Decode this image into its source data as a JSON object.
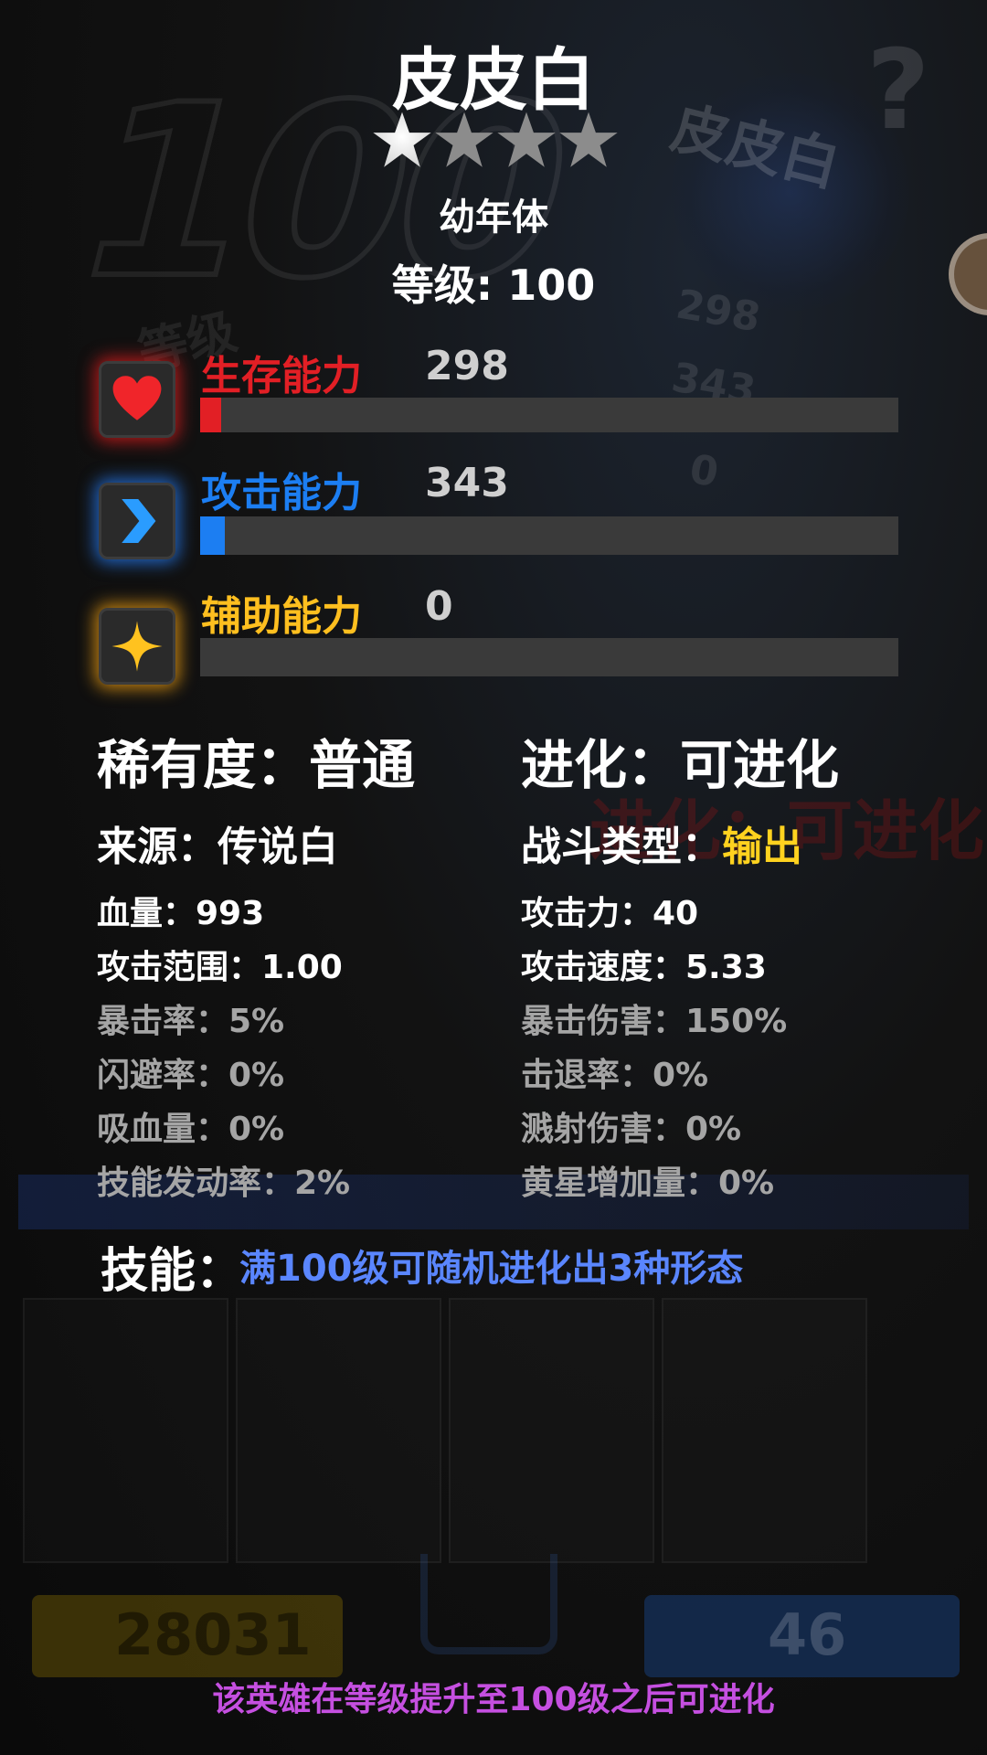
{
  "hero": {
    "name": "皮皮白",
    "stars_filled": 1,
    "stars_total": 4,
    "form": "幼年体",
    "level_label": "等级: 100"
  },
  "abilities": [
    {
      "name": "生存能力",
      "value": "298",
      "fill_fraction": 0.03,
      "color": "#e21f25",
      "icon": "heart-icon"
    },
    {
      "name": "攻击能力",
      "value": "343",
      "fill_fraction": 0.035,
      "color": "#1c7ef2",
      "icon": "chevron-right-icon"
    },
    {
      "name": "辅助能力",
      "value": "0",
      "fill_fraction": 0.0,
      "color": "#ffbf1f",
      "icon": "sparkle-star-icon"
    }
  ],
  "info": {
    "rarity": "稀有度：普通",
    "evolution": "进化：可进化",
    "source": "来源：传说白",
    "battle_type_label": "战斗类型：",
    "battle_type_value": "输出",
    "battle_type_color": "#ffd21f"
  },
  "stats_left": [
    {
      "text": "血量：993",
      "tone": "white"
    },
    {
      "text": "攻击范围：1.00",
      "tone": "white"
    },
    {
      "text": "暴击率：5%",
      "tone": "gray"
    },
    {
      "text": "闪避率：0%",
      "tone": "gray"
    },
    {
      "text": "吸血量：0%",
      "tone": "gray"
    },
    {
      "text": "技能发动率：2%",
      "tone": "gray"
    }
  ],
  "stats_right": [
    {
      "text": "攻击力：40",
      "tone": "white"
    },
    {
      "text": "攻击速度：5.33",
      "tone": "white"
    },
    {
      "text": "暴击伤害：150%",
      "tone": "gray"
    },
    {
      "text": "击退率：0%",
      "tone": "gray"
    },
    {
      "text": "溅射伤害：0%",
      "tone": "gray"
    },
    {
      "text": "黄星增加量：0%",
      "tone": "gray"
    }
  ],
  "skill": {
    "label": "技能：",
    "text": "满100级可随机进化出3种形态"
  },
  "background": {
    "big_level": "100",
    "level_word": "等级",
    "hero_name": "皮皮白",
    "num_a": "298",
    "num_b": "343",
    "num_c": "0",
    "evo_text": "进化：可进化",
    "gold_amount": "28031",
    "gem_amount": "46"
  },
  "footer_hint": "该英雄在等级提升至100级之后可进化"
}
